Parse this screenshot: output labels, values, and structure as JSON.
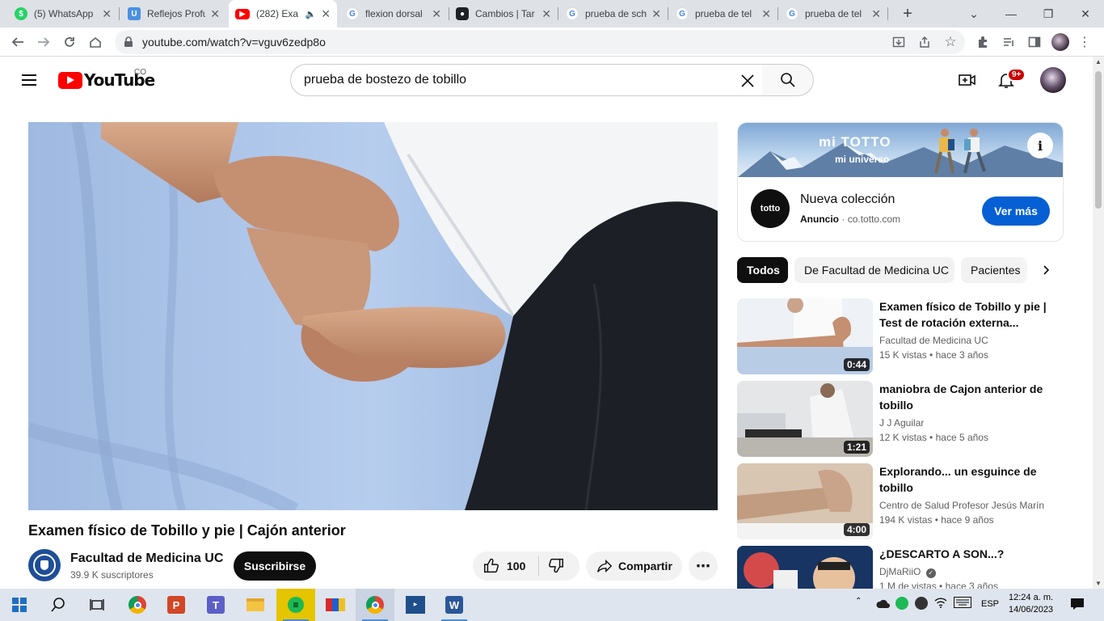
{
  "browser": {
    "tabs": [
      {
        "title": "(5) WhatsApp",
        "favicon": "whatsapp-icon",
        "color": "#25d366"
      },
      {
        "title": "Reflejos Profu",
        "favicon": "document-icon",
        "color": "#4a90e2"
      },
      {
        "title": "(282) Exa",
        "favicon": "youtube-icon",
        "color": "#ff0000",
        "active": true,
        "audio": true
      },
      {
        "title": "flexion dorsal",
        "favicon": "google-icon",
        "color": "#4285f4"
      },
      {
        "title": "Cambios | Tar",
        "favicon": "mask-icon",
        "color": "#202124"
      },
      {
        "title": "prueba de sch",
        "favicon": "google-icon",
        "color": "#4285f4"
      },
      {
        "title": "prueba de tel",
        "favicon": "google-icon",
        "color": "#4285f4"
      },
      {
        "title": "prueba de tel",
        "favicon": "google-icon",
        "color": "#4285f4"
      }
    ],
    "url": "youtube.com/watch?v=vguv6zedp8o"
  },
  "youtube": {
    "logo_text": "YouTube",
    "country_code": "CO",
    "search_query": "prueba de bostezo de tobillo",
    "notification_count": "9+"
  },
  "video": {
    "title": "Examen físico de Tobillo y pie | Cajón anterior",
    "channel": "Facultad de Medicina UC",
    "subscribers": "39.9 K suscriptores",
    "subscribe_label": "Suscribirse",
    "likes": "100",
    "share_label": "Compartir"
  },
  "ad": {
    "banner_brand": "mi TOTTO",
    "banner_tagline": "mi universo",
    "logo_text": "totto",
    "title": "Nueva colección",
    "label": "Anuncio",
    "domain": "co.totto.com",
    "cta": "Ver más"
  },
  "chips": [
    "Todos",
    "De Facultad de Medicina UC",
    "Pacientes"
  ],
  "recommendations": [
    {
      "title": "Examen físico de Tobillo y pie | Test de rotación externa...",
      "channel": "Facultad de Medicina UC",
      "views": "15 K vistas",
      "age": "hace 3 años",
      "duration": "0:44",
      "verified": false
    },
    {
      "title": "maniobra de Cajon anterior de tobillo",
      "channel": "J J Aguilar",
      "views": "12 K vistas",
      "age": "hace 5 años",
      "duration": "1:21",
      "verified": false
    },
    {
      "title": "Explorando... un esguince de tobillo",
      "channel": "Centro de Salud Profesor Jesús Marín",
      "views": "194 K vistas",
      "age": "hace 9 años",
      "duration": "4:00",
      "verified": false
    },
    {
      "title": "¿DESCARTO A SON...?",
      "channel": "DjMaRiiO",
      "views": "1 M de vistas",
      "age": "hace 3 años",
      "duration": "",
      "verified": true
    }
  ],
  "taskbar": {
    "language": "ESP",
    "time": "12:24 a. m.",
    "date": "14/06/2023"
  }
}
